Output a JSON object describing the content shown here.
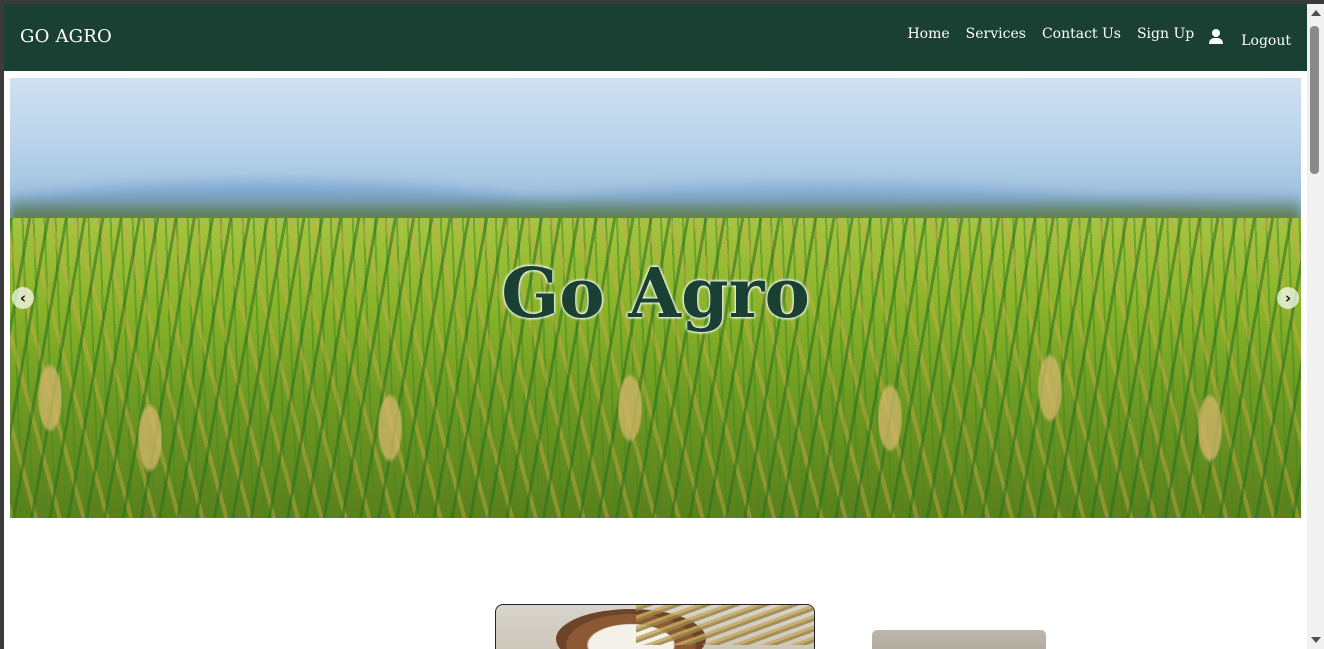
{
  "navbar": {
    "brand": "GO AGRO",
    "links": [
      {
        "label": "Home"
      },
      {
        "label": "Services"
      },
      {
        "label": "Contact Us"
      },
      {
        "label": "Sign Up"
      }
    ],
    "user_icon": "user-icon",
    "logout_label": "Logout",
    "background_color": "#1a4033"
  },
  "hero": {
    "title": "Go Agro",
    "title_color": "#1a4033",
    "prev_icon": "chevron-left-icon",
    "next_icon": "chevron-right-icon",
    "prev_glyph": "‹",
    "next_glyph": "›"
  }
}
